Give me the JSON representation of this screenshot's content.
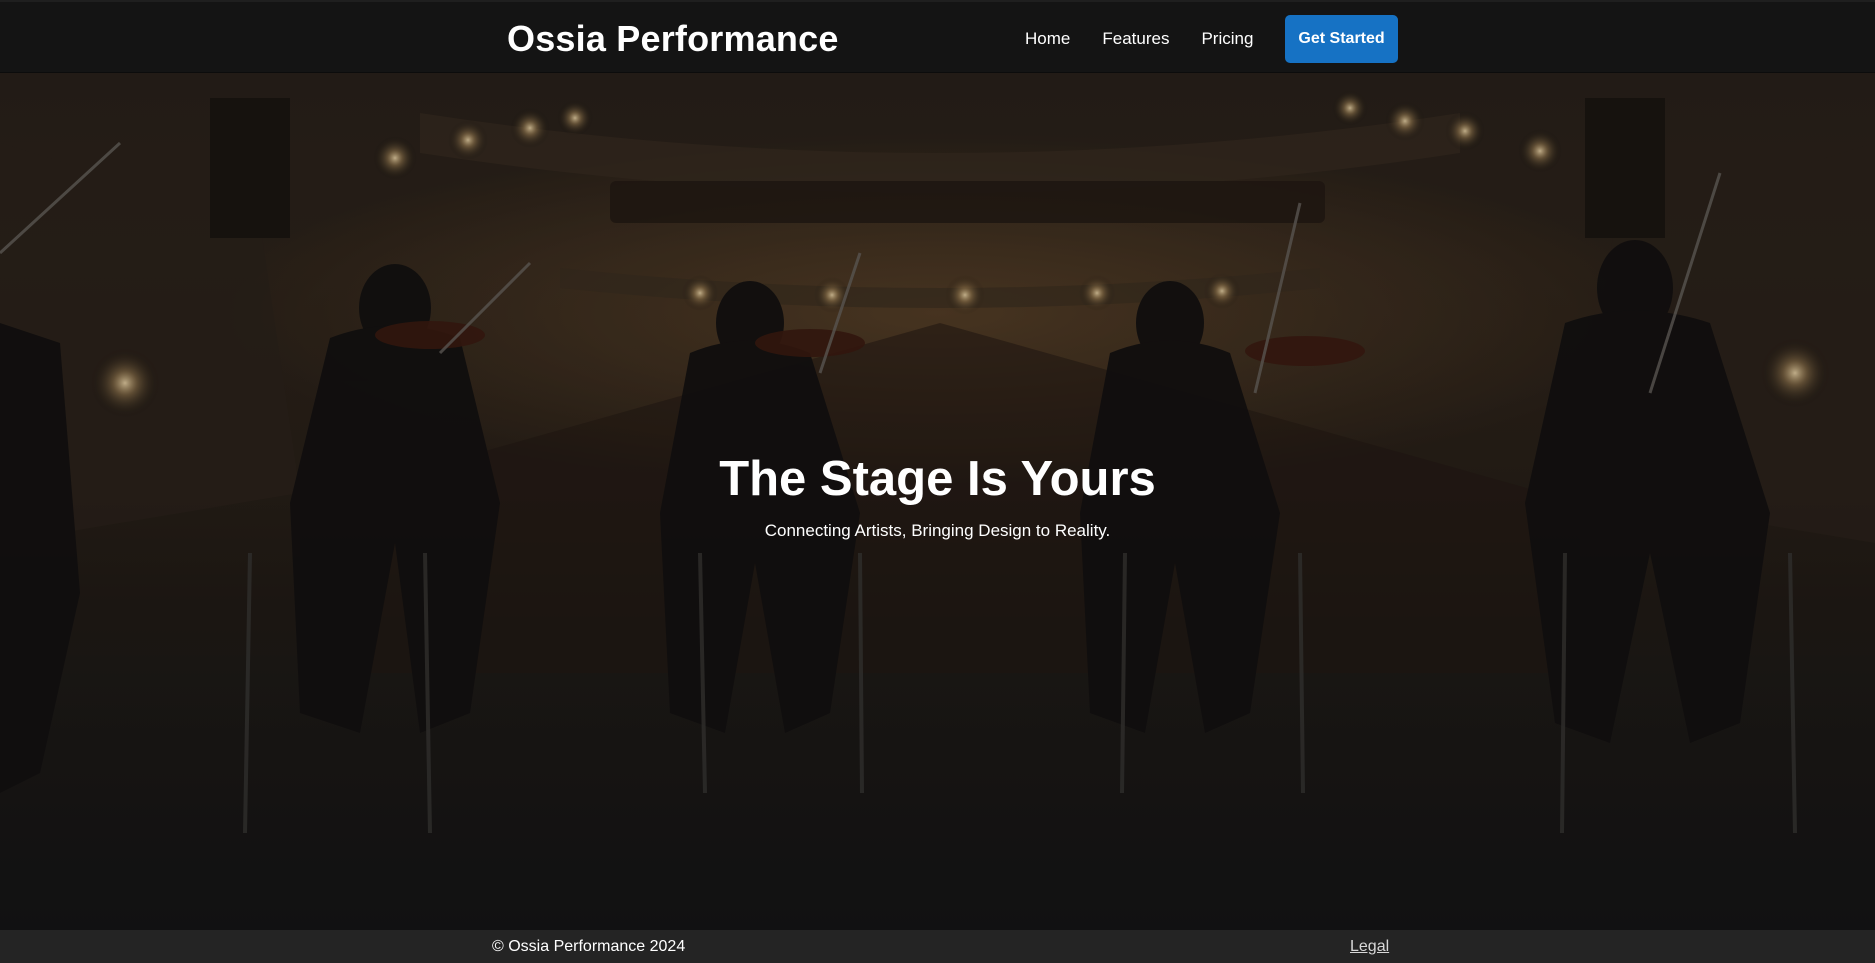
{
  "brand": "Ossia Performance",
  "nav": {
    "links": [
      "Home",
      "Features",
      "Pricing"
    ],
    "cta_label": "Get Started"
  },
  "hero": {
    "title": "The Stage Is Yours",
    "subtitle": "Connecting Artists, Bringing Design to Reality."
  },
  "footer": {
    "copyright": "© Ossia Performance 2024",
    "legal": "Legal"
  },
  "colors": {
    "nav_background": "#141414",
    "cta_background": "#1672c4",
    "footer_background": "#242424"
  }
}
